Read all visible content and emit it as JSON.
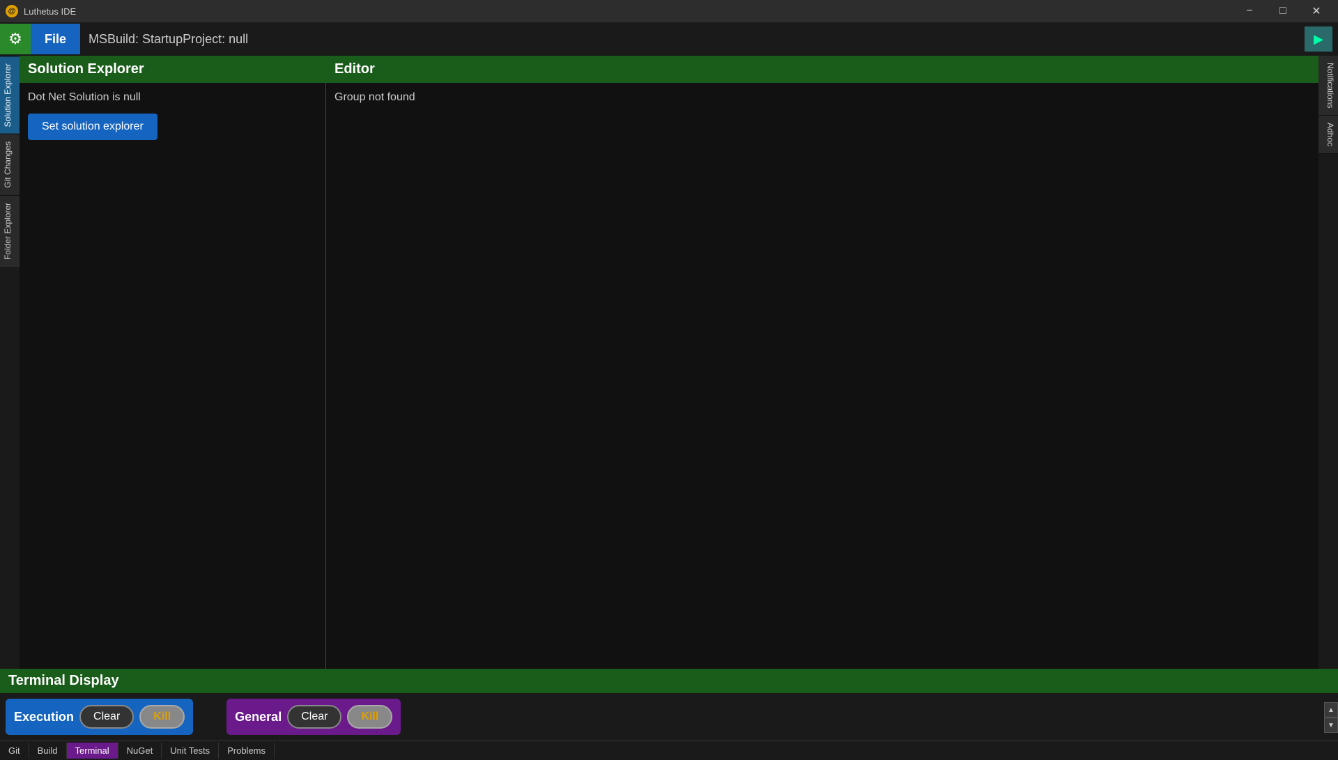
{
  "titleBar": {
    "icon": "@",
    "title": "Luthetus IDE",
    "minimize": "−",
    "maximize": "□",
    "close": "✕"
  },
  "menuBar": {
    "gearIcon": "⚙",
    "fileLabel": "File",
    "buildCommand": "MSBuild: StartupProject:  null",
    "runIcon": "▶"
  },
  "leftSidebar": {
    "tabs": [
      {
        "label": "Solution Explorer",
        "active": true
      },
      {
        "label": "Git Changes",
        "active": false
      },
      {
        "label": "Folder Explorer",
        "active": false
      }
    ]
  },
  "solutionExplorer": {
    "header": "Solution Explorer",
    "nullText": "Dot Net Solution is null",
    "setButton": "Set solution explorer"
  },
  "editor": {
    "header": "Editor",
    "content": "Group not found"
  },
  "rightSidebar": {
    "tabs": [
      {
        "label": "Notifications"
      },
      {
        "label": "Adhoc"
      }
    ]
  },
  "terminal": {
    "header": "Terminal Display",
    "execution": {
      "label": "Execution",
      "clearLabel": "Clear",
      "killLabel": "Kill"
    },
    "general": {
      "label": "General",
      "clearLabel": "Clear",
      "killLabel": "Kill"
    }
  },
  "bottomTabs": {
    "tabs": [
      {
        "label": "Git",
        "active": false
      },
      {
        "label": "Build",
        "active": false
      },
      {
        "label": "Terminal",
        "active": true
      },
      {
        "label": "NuGet",
        "active": false
      },
      {
        "label": "Unit Tests",
        "active": false
      },
      {
        "label": "Problems",
        "active": false
      }
    ]
  },
  "scrollbar": {
    "upArrow": "▲",
    "downArrow": "▼"
  }
}
